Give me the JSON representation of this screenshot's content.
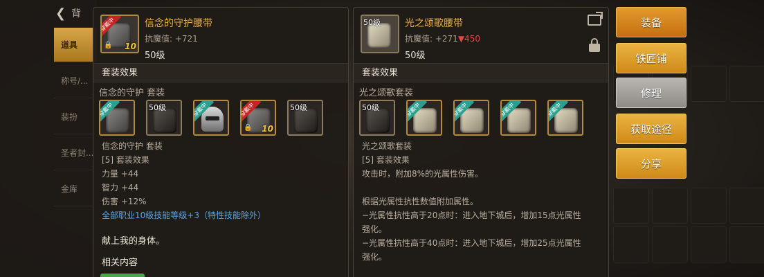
{
  "backdrop": {
    "back_label": "背",
    "nav_items": [
      "道具",
      "称号/...",
      "装扮",
      "圣者封...",
      "金库"
    ]
  },
  "left_panel": {
    "item": {
      "title": "信念的守护腰带",
      "stat_label": "抗魔值: +721",
      "level": "50级",
      "badge": "穿戴中",
      "grade": "10"
    },
    "section_title": "套装效果",
    "set_name": "信念的守护  套装",
    "slots": [
      {
        "type": "armor",
        "ribbon": "穿戴中",
        "ribbon_color": "teal"
      },
      {
        "type": "dark",
        "level": "50级"
      },
      {
        "type": "helm",
        "ribbon": "穿戴中",
        "ribbon_color": "teal"
      },
      {
        "type": "armor",
        "ribbon": "穿戴中",
        "ribbon_color": "red",
        "grade": "10"
      },
      {
        "type": "dark",
        "level": "50级"
      }
    ],
    "desc_lines": [
      {
        "text": "信念的守护  套装",
        "style": "normal"
      },
      {
        "text": "[5] 套装效果",
        "style": "normal"
      },
      {
        "text": "力量 +44",
        "style": "normal"
      },
      {
        "text": "智力 +44",
        "style": "normal"
      },
      {
        "text": "伤害 +12%",
        "style": "normal"
      },
      {
        "text": "全部职业10级技能等级+3（特性技能除外）",
        "style": "blue"
      }
    ],
    "quote": "献上我的身体。",
    "related_title": "相关内容"
  },
  "right_panel": {
    "item": {
      "title": "光之颂歌腰带",
      "stat_label": "抗魔值: +271",
      "stat_delta": "▼450",
      "level": "50级",
      "icon_level": "50级"
    },
    "section_title": "套装效果",
    "set_name": "光之颂歌套装",
    "slots": [
      {
        "type": "dark",
        "level": "50级"
      },
      {
        "type": "cloth",
        "ribbon": "穿戴中",
        "ribbon_color": "teal"
      },
      {
        "type": "cloth",
        "ribbon": "穿戴中",
        "ribbon_color": "teal"
      },
      {
        "type": "cloth",
        "ribbon": "穿戴中",
        "ribbon_color": "teal"
      },
      {
        "type": "cloth",
        "ribbon": "穿戴中",
        "ribbon_color": "teal"
      }
    ],
    "desc_lines": [
      "光之颂歌套装",
      "[5] 套装效果",
      "攻击时，附加8%的光属性伤害。",
      "",
      "根据光属性抗性数值附加属性。",
      "−光属性抗性高于20点时：进入地下城后，增加15点光属性",
      "强化。",
      "−光属性抗性高于40点时：进入地下城后，增加25点光属性",
      "强化。"
    ]
  },
  "actions": {
    "equip": "装备",
    "blacksmith": "铁匠铺",
    "repair": "修理",
    "obtain": "获取途径",
    "share": "分享"
  },
  "colors": {
    "title_gold": "#e9b040",
    "blue_text": "#58a6e8",
    "down_red": "#e24848",
    "button_orange": "#d4841f",
    "button_gray": "#a4a19c"
  }
}
